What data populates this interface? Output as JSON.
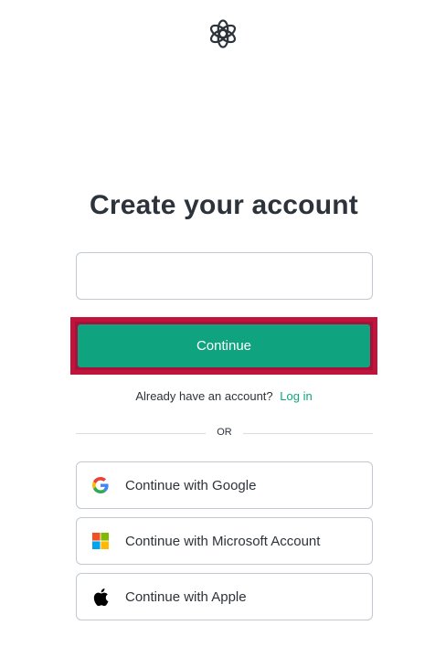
{
  "page": {
    "title": "Create your account"
  },
  "form": {
    "email_value": "",
    "continue_label": "Continue"
  },
  "login": {
    "prompt": "Already have an account?",
    "link_label": "Log in"
  },
  "divider": {
    "label": "OR"
  },
  "social": {
    "google_label": "Continue with Google",
    "microsoft_label": "Continue with Microsoft Account",
    "apple_label": "Continue with Apple"
  },
  "colors": {
    "accent": "#10a37f",
    "highlight_border": "#c0143c",
    "text": "#2d333a",
    "border": "#c2c8d0"
  },
  "icons": {
    "logo": "openai-logo-icon",
    "google": "google-icon",
    "microsoft": "microsoft-icon",
    "apple": "apple-icon"
  }
}
